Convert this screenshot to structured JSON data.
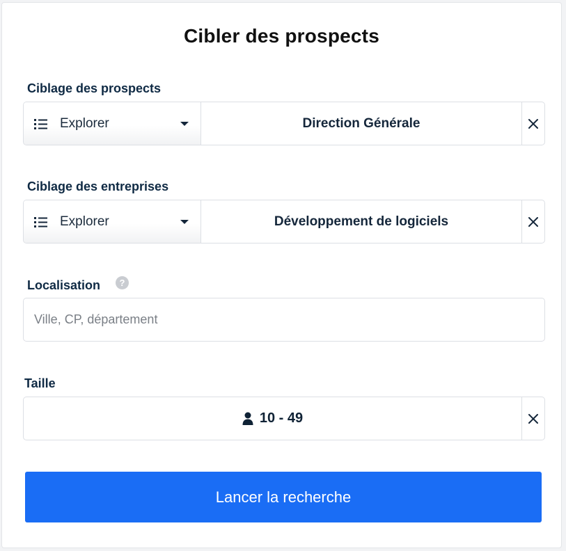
{
  "title": "Cibler des prospects",
  "prospects": {
    "label": "Ciblage des prospects",
    "dropdown_label": "Explorer",
    "value": "Direction Générale"
  },
  "companies": {
    "label": "Ciblage des entreprises",
    "dropdown_label": "Explorer",
    "value": "Développement de logiciels"
  },
  "location": {
    "label": "Localisation",
    "help": "?",
    "placeholder": "Ville, CP, département"
  },
  "size": {
    "label": "Taille",
    "value": "10 - 49"
  },
  "search_button_label": "Lancer la recherche",
  "icons": {
    "list": "list-icon",
    "caret": "caret-down-icon",
    "clear": "close-icon",
    "help": "help-icon",
    "user": "user-icon"
  },
  "colors": {
    "primary": "#1a6df5",
    "label_text": "#0f2a44"
  }
}
